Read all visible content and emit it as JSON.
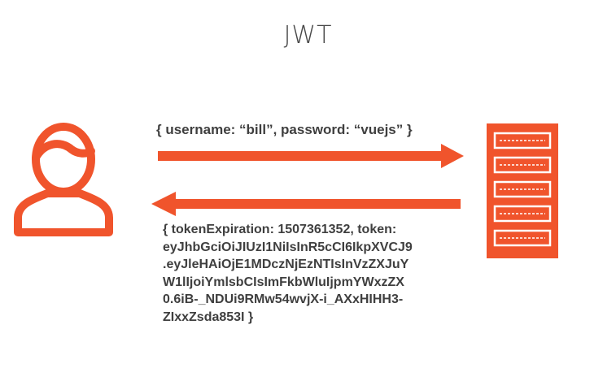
{
  "title": "JWT",
  "request": {
    "text": "{ username: “bill”, password: “vuejs” }"
  },
  "response": {
    "text": "{ tokenExpiration: 1507361352, token:\neyJhbGciOiJIUzI1NiIsInR5cCI6IkpXVCJ9\n.eyJleHAiOjE1MDczNjEzNTIsInVzZXJuY\nW1lIjoiYmlsbCIsImFkbWluIjpmYWxzZX\n0.6iB-_NDUi9RMw54wvjX-i_AXxHIHH3-\nZIxxZsda853I }"
  },
  "colors": {
    "accent": "#f0542c",
    "text": "#3f3f3f",
    "title": "#4a4a4a"
  },
  "icons": {
    "client": "user-icon",
    "server": "server-rack-icon"
  }
}
